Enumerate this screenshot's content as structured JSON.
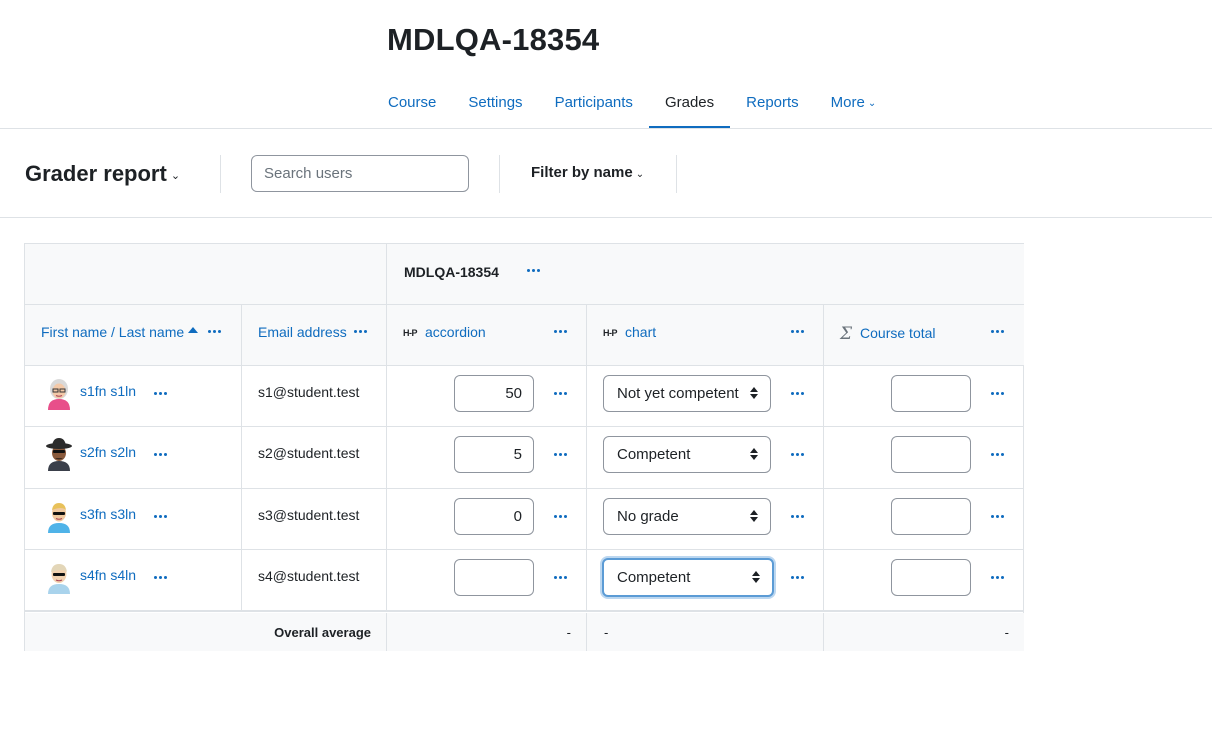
{
  "course": {
    "title": "MDLQA-18354"
  },
  "nav": {
    "items": [
      {
        "label": "Course"
      },
      {
        "label": "Settings"
      },
      {
        "label": "Participants"
      },
      {
        "label": "Grades"
      },
      {
        "label": "Reports"
      },
      {
        "label": "More"
      }
    ],
    "active": "Grades"
  },
  "tertiary": {
    "report_title": "Grader report",
    "search_placeholder": "Search users",
    "filter_label": "Filter by name"
  },
  "grader": {
    "category_title": "MDLQA-18354",
    "headers": {
      "name": "First name / Last name",
      "email": "Email address",
      "accordion": "accordion",
      "chart": "chart",
      "course_total": "Course total"
    },
    "icons": {
      "h5p": "H-P",
      "sigma": "Σ"
    },
    "rows": [
      {
        "name": "s1fn s1ln",
        "email": "s1@student.test",
        "accordion": "50",
        "chart": "Not yet competent",
        "total": ""
      },
      {
        "name": "s2fn s2ln",
        "email": "s2@student.test",
        "accordion": "5",
        "chart": "Competent",
        "total": ""
      },
      {
        "name": "s3fn s3ln",
        "email": "s3@student.test",
        "accordion": "0",
        "chart": "No grade",
        "total": ""
      },
      {
        "name": "s4fn s4ln",
        "email": "s4@student.test",
        "accordion": "",
        "chart": "Competent",
        "total": ""
      }
    ],
    "overall": {
      "label": "Overall average",
      "accordion": "-",
      "chart": "-",
      "total": "-"
    }
  },
  "colors": {
    "link": "#0f6cbf",
    "border": "#dee2e6",
    "header_bg": "#f8f9fa",
    "focus": "#5b9bd5"
  }
}
